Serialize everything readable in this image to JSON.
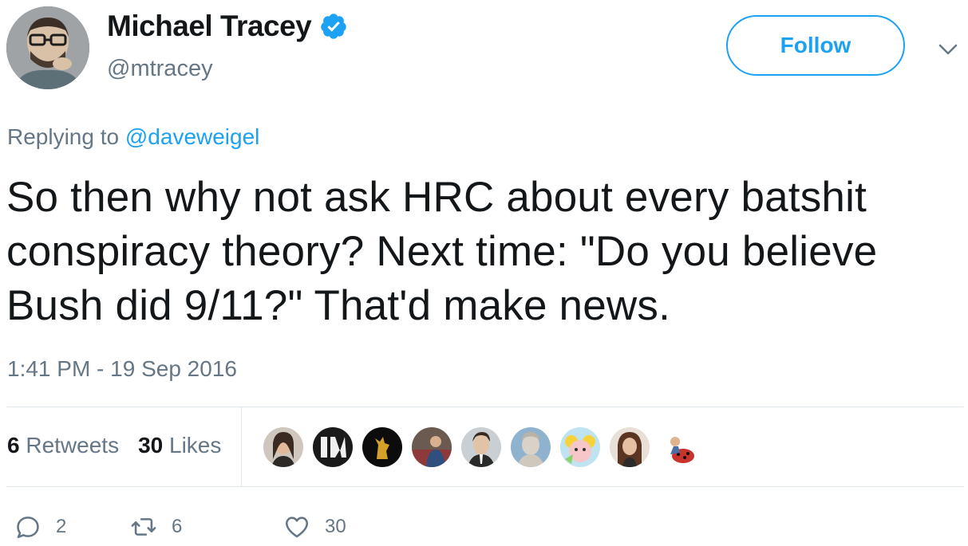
{
  "author": {
    "display_name": "Michael Tracey",
    "handle": "@mtracey",
    "verified": true
  },
  "follow_label": "Follow",
  "reply": {
    "prefix": "Replying to",
    "mention": "@daveweigel"
  },
  "tweet": {
    "text": "So then why not ask HRC about every batshit\nconspiracy theory? Next time: \"Do you believe\nBush did 9/11?\" That'd make news.",
    "timestamp": "1:41 PM - 19 Sep 2016"
  },
  "stats": {
    "retweets_count": "6",
    "retweets_label": "Retweets",
    "likes_count": "30",
    "likes_label": "Likes"
  },
  "actions": {
    "replies": "2",
    "retweets": "6",
    "likes": "30"
  },
  "colors": {
    "accent": "#1da1f2",
    "secondary_text": "#657786",
    "divider": "#e1e8ed"
  },
  "icons": [
    "verified-badge-icon",
    "chevron-down-icon",
    "reply-icon",
    "retweet-icon",
    "heart-icon"
  ],
  "liker_avatars_count": 9
}
